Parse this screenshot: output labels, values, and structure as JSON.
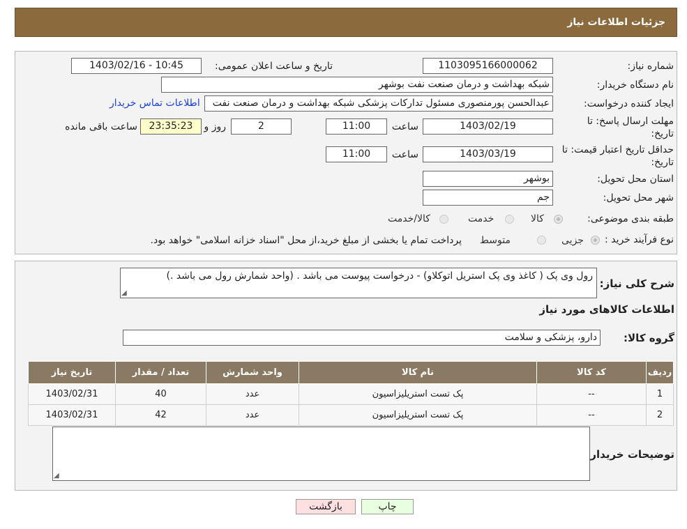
{
  "header": {
    "title": "جزئیات اطلاعات نیاز"
  },
  "form": {
    "need_number_label": "شماره نیاز:",
    "need_number": "1103095166000062",
    "announce_label": "تاریخ و ساعت اعلان عمومی:",
    "announce_value": "1403/02/16 - 10:45",
    "buyer_org_label": "نام دستگاه خریدار:",
    "buyer_org": "شبکه بهداشت و درمان صنعت نفت بوشهر",
    "creator_label": "ایجاد کننده درخواست:",
    "creator": "عبدالحسن پورمنصوری مسئول تدارکات پزشکی شبکه بهداشت و درمان صنعت نفت",
    "contact_link": "اطلاعات تماس خریدار",
    "deadline_label_1": "مهلت ارسال پاسخ: تا",
    "deadline_label_2": "تاریخ:",
    "deadline_date": "1403/02/19",
    "time_label": "ساعت",
    "deadline_time": "11:00",
    "days_value": "2",
    "days_label": "روز و",
    "remaining_value": "23:35:23",
    "remaining_label": "ساعت باقی مانده",
    "validity_label_1": "حداقل تاریخ اعتبار قیمت: تا",
    "validity_label_2": "تاریخ:",
    "validity_date": "1403/03/19",
    "validity_time_label": "ساعت",
    "validity_time": "11:00",
    "province_label": "استان محل تحویل:",
    "province": "بوشهر",
    "city_label": "شهر محل تحویل:",
    "city": "جم",
    "category_label": "طبقه بندی موضوعی:",
    "category_options": [
      "کالا",
      "خدمت",
      "کالا/خدمت"
    ],
    "process_label": "نوع فرآیند خرید :",
    "process_options": [
      "جزیی",
      "متوسط"
    ],
    "process_note": "پرداخت تمام یا بخشی از مبلغ خرید،از محل \"اسناد خزانه اسلامی\" خواهد بود."
  },
  "details": {
    "desc_label": "شرح کلی نیاز:",
    "description": "رول وی پک ( کاغذ وی پک استریل اتوکلاو) - درخواست پیوست می باشد . (واحد شمارش رول می باشد .)",
    "goods_info_title": "اطلاعات کالاهای مورد نیاز",
    "group_label": "گروه کالا:",
    "group_value": "دارو، پزشکی و سلامت",
    "table": {
      "headers": [
        "ردیف",
        "کد کالا",
        "نام کالا",
        "واحد شمارش",
        "تعداد / مقدار",
        "تاریخ نیاز"
      ],
      "rows": [
        [
          "1",
          "--",
          "پک تست استریلیزاسیون",
          "عدد",
          "40",
          "1403/02/31"
        ],
        [
          "2",
          "--",
          "پک تست استریلیزاسیون",
          "عدد",
          "42",
          "1403/02/31"
        ]
      ]
    },
    "buyer_notes_label": "توضیحات خریدار:",
    "buyer_notes": ""
  },
  "buttons": {
    "print": "چاپ",
    "back": "بازگشت"
  },
  "colors": {
    "header_bg": "#8b6a3d",
    "table_header_bg": "#8b7a63",
    "link": "#1a3fd6",
    "back_btn": "#ffe0e0",
    "print_btn": "#e8ffe0"
  }
}
